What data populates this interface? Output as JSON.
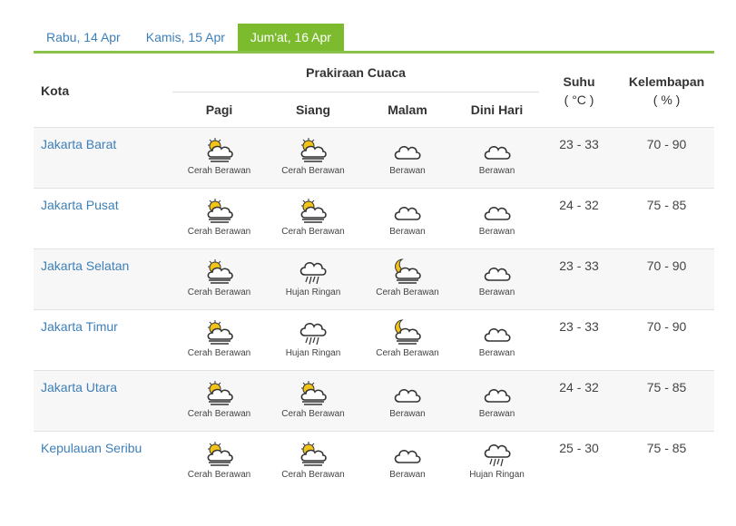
{
  "tabs": [
    {
      "label": "Rabu, 14 Apr",
      "active": false
    },
    {
      "label": "Kamis, 15 Apr",
      "active": false
    },
    {
      "label": "Jum'at, 16 Apr",
      "active": true
    }
  ],
  "header": {
    "kota": "Kota",
    "prakiraan": "Prakiraan Cuaca",
    "suhu": "Suhu",
    "suhu_unit": "( °C )",
    "kelembapan": "Kelembapan",
    "kelembapan_unit": "( % )",
    "periods": [
      "Pagi",
      "Siang",
      "Malam",
      "Dini Hari"
    ]
  },
  "rows": [
    {
      "city": "Jakarta Barat",
      "forecast": [
        {
          "label": "Cerah Berawan",
          "icon": "sun-cloud-fog-icon"
        },
        {
          "label": "Cerah Berawan",
          "icon": "sun-cloud-fog-icon"
        },
        {
          "label": "Berawan",
          "icon": "cloud-icon"
        },
        {
          "label": "Berawan",
          "icon": "cloud-icon"
        }
      ],
      "suhu": "23 - 33",
      "kelembapan": "70 - 90"
    },
    {
      "city": "Jakarta Pusat",
      "forecast": [
        {
          "label": "Cerah Berawan",
          "icon": "sun-cloud-fog-icon"
        },
        {
          "label": "Cerah Berawan",
          "icon": "sun-cloud-fog-icon"
        },
        {
          "label": "Berawan",
          "icon": "cloud-icon"
        },
        {
          "label": "Berawan",
          "icon": "cloud-icon"
        }
      ],
      "suhu": "24 - 32",
      "kelembapan": "75 - 85"
    },
    {
      "city": "Jakarta Selatan",
      "forecast": [
        {
          "label": "Cerah Berawan",
          "icon": "sun-cloud-fog-icon"
        },
        {
          "label": "Hujan Ringan",
          "icon": "cloud-rain-icon"
        },
        {
          "label": "Cerah Berawan",
          "icon": "moon-cloud-fog-icon"
        },
        {
          "label": "Berawan",
          "icon": "cloud-icon"
        }
      ],
      "suhu": "23 - 33",
      "kelembapan": "70 - 90"
    },
    {
      "city": "Jakarta Timur",
      "forecast": [
        {
          "label": "Cerah Berawan",
          "icon": "sun-cloud-fog-icon"
        },
        {
          "label": "Hujan Ringan",
          "icon": "cloud-rain-icon"
        },
        {
          "label": "Cerah Berawan",
          "icon": "moon-cloud-fog-icon"
        },
        {
          "label": "Berawan",
          "icon": "cloud-icon"
        }
      ],
      "suhu": "23 - 33",
      "kelembapan": "70 - 90"
    },
    {
      "city": "Jakarta Utara",
      "forecast": [
        {
          "label": "Cerah Berawan",
          "icon": "sun-cloud-fog-icon"
        },
        {
          "label": "Cerah Berawan",
          "icon": "sun-cloud-fog-icon"
        },
        {
          "label": "Berawan",
          "icon": "cloud-icon"
        },
        {
          "label": "Berawan",
          "icon": "cloud-icon"
        }
      ],
      "suhu": "24 - 32",
      "kelembapan": "75 - 85"
    },
    {
      "city": "Kepulauan Seribu",
      "forecast": [
        {
          "label": "Cerah Berawan",
          "icon": "sun-cloud-fog-icon"
        },
        {
          "label": "Cerah Berawan",
          "icon": "sun-cloud-fog-icon"
        },
        {
          "label": "Berawan",
          "icon": "cloud-icon"
        },
        {
          "label": "Hujan Ringan",
          "icon": "cloud-rain-icon"
        }
      ],
      "suhu": "25 - 30",
      "kelembapan": "75 - 85"
    }
  ],
  "colors": {
    "accent_green": "#7cbb2e",
    "link_blue": "#3d7fb8",
    "sun_yellow": "#f2c318"
  }
}
